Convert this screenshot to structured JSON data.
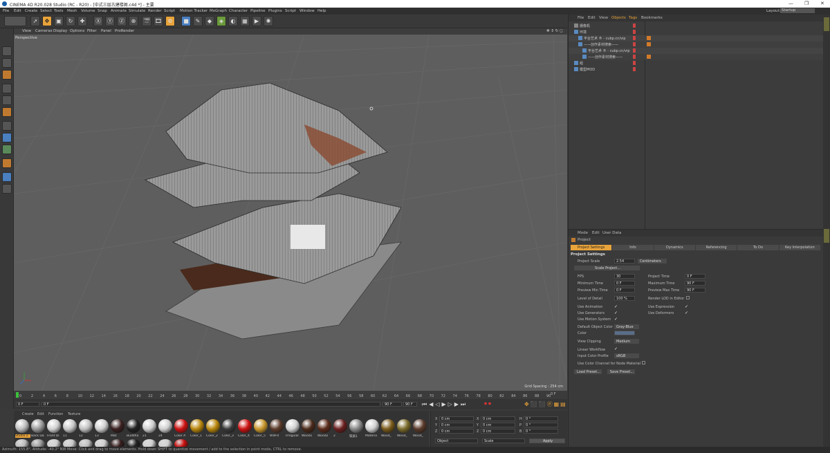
{
  "window": {
    "title": "CINEMA 4D R20.028 Studio (RC - R20) - [中式三层古建楼阁.c4d *] - 主要",
    "min": "—",
    "max": "❐",
    "close": "✕"
  },
  "menu": [
    "File",
    "Edit",
    "Create",
    "Select",
    "Tools",
    "Mesh",
    "Volume",
    "Snap",
    "Animate",
    "Simulate",
    "Render",
    "Script",
    "Motion Tracker",
    "MoGraph",
    "Character",
    "Pipeline",
    "Plugins",
    "Script",
    "Window",
    "Help"
  ],
  "layout": {
    "label": "Layout:",
    "value": "Startup"
  },
  "viewport": {
    "menu": [
      "View",
      "Cameras",
      "Display",
      "Options",
      "Filter",
      "Panel",
      "ProRender"
    ],
    "camera": "Perspective",
    "grid_spacing": "Grid Spacing : 254 cm"
  },
  "timeline": {
    "ticks": [
      "0",
      "2",
      "4",
      "6",
      "8",
      "10",
      "12",
      "14",
      "16",
      "18",
      "20",
      "22",
      "24",
      "26",
      "28",
      "30",
      "32",
      "34",
      "36",
      "38",
      "40",
      "42",
      "44",
      "46",
      "48",
      "50",
      "52",
      "54",
      "56",
      "58",
      "60",
      "62",
      "64",
      "66",
      "68",
      "70",
      "72",
      "74",
      "76",
      "78",
      "80",
      "82",
      "84",
      "86",
      "88",
      "90"
    ],
    "end_label": "0 F"
  },
  "transport": {
    "start": "0 F",
    "current": "0 F",
    "end": "90 F",
    "end2": "90 F"
  },
  "materials": {
    "menu": [
      "Create",
      "Edit",
      "Function",
      "Texture"
    ],
    "row1": [
      {
        "label": "Studio Z",
        "color": "#bdbdbd"
      },
      {
        "label": "Back Da",
        "color": "#9a9a9a"
      },
      {
        "label": "Front Di",
        "color": "#d0d0d0"
      },
      {
        "label": "11",
        "color": "#c8c8c8"
      },
      {
        "label": "12",
        "color": "#c0c0c0"
      },
      {
        "label": "13",
        "color": "#cfcfcf"
      },
      {
        "label": "Mat",
        "color": "#3a2020"
      },
      {
        "label": "Buddha",
        "color": "#222222"
      },
      {
        "label": "21",
        "color": "#cfcfcf"
      },
      {
        "label": "24",
        "color": "#cfcfcf"
      },
      {
        "label": "Color A",
        "color": "#cc1111"
      },
      {
        "label": "Color_1",
        "color": "#b8860b"
      },
      {
        "label": "Color_2",
        "color": "#b8860b"
      },
      {
        "label": "Color_3",
        "color": "#3a3a3a"
      },
      {
        "label": "Color_4",
        "color": "#cc1111"
      },
      {
        "label": "Color_5",
        "color": "#c8962b"
      },
      {
        "label": "WW-0",
        "color": "#5a3a2a"
      },
      {
        "label": "Irregular",
        "color": "#d0d0d0"
      },
      {
        "label": "Wood1",
        "color": "#4a2a1a"
      },
      {
        "label": "Wood2",
        "color": "#5a2a1a"
      },
      {
        "label": "2",
        "color": "#6a1f1f"
      },
      {
        "label": "铁质1",
        "color": "#888888"
      },
      {
        "label": "Materia",
        "color": "#cfcfcf"
      },
      {
        "label": "Wood_",
        "color": "#7a5a1a"
      },
      {
        "label": "Wood_",
        "color": "#7a6a2a"
      },
      {
        "label": "Wood_",
        "color": "#5a3a2a"
      }
    ]
  },
  "coords": {
    "rows": [
      {
        "a": "X",
        "av": "0 cm",
        "b": "X",
        "bv": "0 cm",
        "c": "H",
        "cv": "0 °"
      },
      {
        "a": "Y",
        "av": "0 cm",
        "b": "Y",
        "bv": "0 cm",
        "c": "P",
        "cv": "0 °"
      },
      {
        "a": "Z",
        "av": "0 cm",
        "b": "Z",
        "bv": "0 cm",
        "c": "B",
        "cv": "0 °"
      }
    ],
    "mode1": "Object",
    "mode2": "Scale",
    "apply": "Apply"
  },
  "objects": {
    "menu": [
      "File",
      "Edit",
      "View",
      "Objects",
      "Tags",
      "Bookmarks"
    ],
    "items": [
      {
        "label": "摄像机",
        "indent": 0
      },
      {
        "label": "环境",
        "indent": 0
      },
      {
        "label": "平台艺术 ® - cubp.cn/vip",
        "indent": 1
      },
      {
        "label": "——创作素材搜索——",
        "indent": 1
      },
      {
        "label": "平台艺术 ® - cubp.cn/vip",
        "indent": 2
      },
      {
        "label": "——创作素材搜索——",
        "indent": 2
      },
      {
        "label": "组",
        "indent": 0
      },
      {
        "label": "模型MOD",
        "indent": 0
      }
    ]
  },
  "attributes": {
    "menu": [
      "Mode",
      "Edit",
      "User Data"
    ],
    "object_name": "Project",
    "tabs": [
      "Project Settings",
      "Info",
      "Dynamics",
      "Referencing",
      "To Do",
      "Key Interpolation"
    ],
    "section": "Project Settings",
    "project_scale_label": "Project Scale",
    "project_scale_value": "2.54",
    "project_scale_unit": "Centimeters",
    "scale_project_btn": "Scale Project...",
    "fields_left": [
      {
        "label": "FPS",
        "value": "30"
      },
      {
        "label": "Minimum Time",
        "value": "0 F"
      },
      {
        "label": "Preview Min Time",
        "value": "0 F"
      },
      {
        "label": "Level of Detail",
        "value": "100 %"
      }
    ],
    "fields_right": [
      {
        "label": "Project Time",
        "value": "0 F"
      },
      {
        "label": "Maximum Time",
        "value": "90 F"
      },
      {
        "label": "Preview Max Time",
        "value": "90 F"
      },
      {
        "label": "Render LOD in Editor",
        "value": ""
      }
    ],
    "checks_left": [
      "Use Animation",
      "Use Generators",
      "Use Motion System"
    ],
    "checks_right": [
      "Use Expression",
      "Use Deformers"
    ],
    "default_color_label": "Default Object Color",
    "default_color_value": "Gray-Blue",
    "color_label": "Color",
    "view_clipping_label": "View Clipping",
    "view_clipping_value": "Medium",
    "linear_workflow_label": "Linear Workflow",
    "input_color_profile_label": "Input Color Profile",
    "input_color_profile_value": "sRGB",
    "node_material_label": "Use Color Channel for Node Material",
    "load_preset": "Load Preset...",
    "save_preset": "Save Preset..."
  },
  "status": {
    "text": "Azimuth: 155.8°, Altitude: -40.2° NW    Move: Click and drag to move elements. Hold down SHIFT to quantize movement / add to the selection in point mode, CTRL to remove."
  },
  "colors": {
    "accent_orange": "#e8a33a",
    "viewport_bg": "#5e5e5e",
    "tab_active": "#e8a33a"
  }
}
